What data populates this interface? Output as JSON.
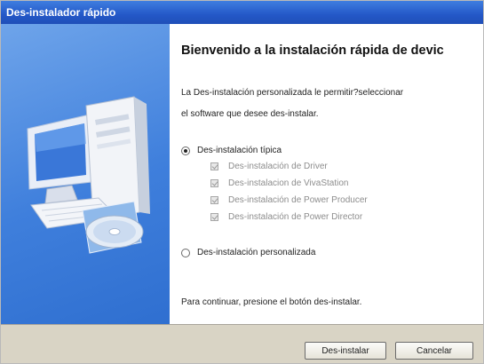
{
  "window": {
    "title": "Des-instalador rápido"
  },
  "content": {
    "heading": "Bienvenido a la instalación rápida de devic",
    "description_line1": "La Des-instalación personalizada le permitir?seleccionar",
    "description_line2": "el software que desee des-instalar.",
    "typical_option": {
      "label": "Des-instalación típica",
      "selected": true
    },
    "components": [
      {
        "label": "Des-instalación de Driver",
        "checked": true,
        "enabled": false
      },
      {
        "label": "Des-instalacion de VivaStation",
        "checked": true,
        "enabled": false
      },
      {
        "label": "Des-instalación de Power Producer",
        "checked": true,
        "enabled": false
      },
      {
        "label": "Des-instalación de Power Director",
        "checked": true,
        "enabled": false
      }
    ],
    "custom_option": {
      "label": "Des-instalación personalizada",
      "selected": false
    },
    "footer_text": "Para continuar, presione el botón des-instalar."
  },
  "buttons": {
    "uninstall_label": "Des-instalar",
    "cancel_label": "Cancelar"
  },
  "colors": {
    "titlebar": "#2458c8",
    "left_panel": "#3f7fdc",
    "button_bar": "#d9d4c5"
  },
  "icons": {
    "illustration": "computer-with-disc-icon"
  }
}
